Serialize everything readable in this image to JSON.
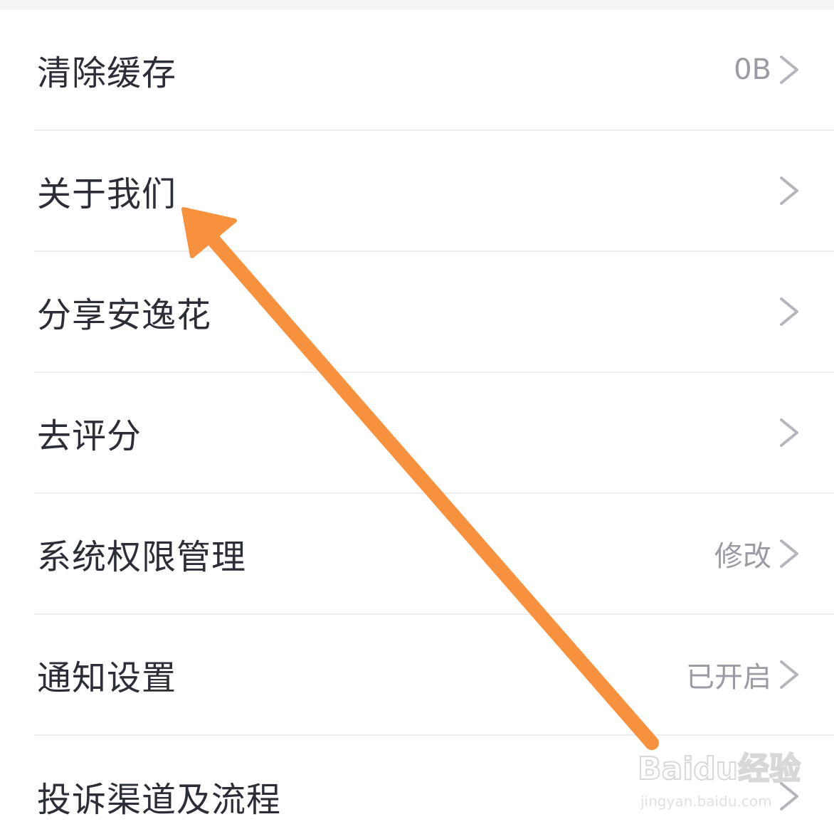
{
  "settings_list": {
    "items": [
      {
        "label": "清除缓存",
        "value": "0B",
        "icon": "chevron-right-icon"
      },
      {
        "label": "关于我们",
        "value": "",
        "icon": "chevron-right-icon"
      },
      {
        "label": "分享安逸花",
        "value": "",
        "icon": "chevron-right-icon"
      },
      {
        "label": "去评分",
        "value": "",
        "icon": "chevron-right-icon"
      },
      {
        "label": "系统权限管理",
        "value": "修改",
        "icon": "chevron-right-icon"
      },
      {
        "label": "通知设置",
        "value": "已开启",
        "icon": "chevron-right-icon"
      },
      {
        "label": "投诉渠道及流程",
        "value": "",
        "icon": "chevron-right-icon"
      }
    ]
  },
  "annotation": {
    "arrow_color": "#f7913d",
    "points_to": "关于我们"
  },
  "watermark": {
    "logo": "Baidu经验",
    "url": "jingyan.baidu.com"
  },
  "colors": {
    "label": "#2b2e36",
    "value": "#9a9ca3",
    "chevron": "#b4b6bc",
    "divider": "#efefef"
  }
}
